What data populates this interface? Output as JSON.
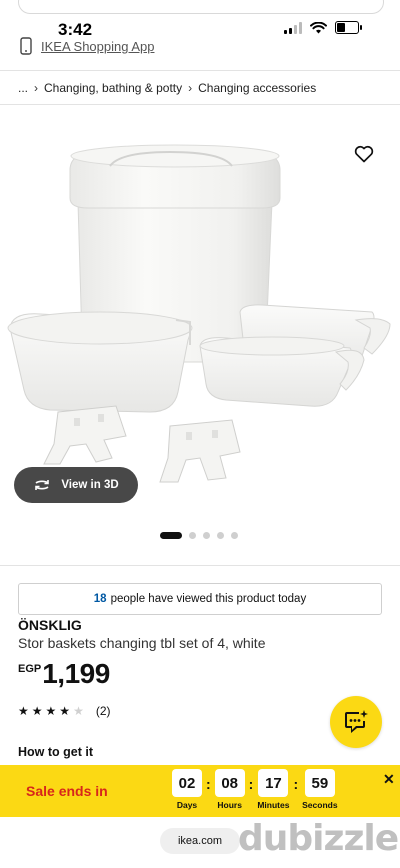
{
  "status_bar": {
    "time": "3:42"
  },
  "app_link": {
    "label": "IKEA Shopping App"
  },
  "breadcrumb": {
    "ellipsis": "...",
    "items": [
      "Changing, bathing & potty",
      "Changing accessories"
    ]
  },
  "gallery": {
    "view_3d_label": "View in 3D",
    "page_count": 5,
    "active_page": 1
  },
  "viewed": {
    "count": "18",
    "text": "people have viewed this product today"
  },
  "product": {
    "name": "ÖNSKLIG",
    "description": "Stor baskets changing tbl set of 4, white",
    "currency": "EGP",
    "price": "1,199",
    "rating": 4,
    "rating_max": 5,
    "review_count": "(2)"
  },
  "how_to_get": "How to get it",
  "sale_banner": {
    "label": "Sale ends in",
    "days": "02",
    "days_label": "Days",
    "hours": "08",
    "hours_label": "Hours",
    "minutes": "17",
    "minutes_label": "Minutes",
    "seconds": "59",
    "seconds_label": "Seconds",
    "close": "✕"
  },
  "browser": {
    "url": "ikea.com"
  },
  "watermark": "dubizzle",
  "colors": {
    "accent_yellow": "#fbd914",
    "sale_red": "#d7261b",
    "link_blue": "#0058a3"
  }
}
